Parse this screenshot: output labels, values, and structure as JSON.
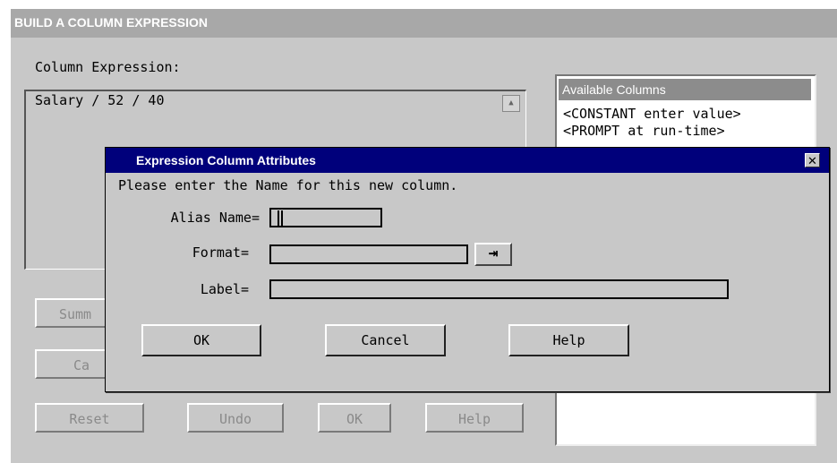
{
  "background_window": {
    "title": "BUILD A COLUMN EXPRESSION",
    "expression_label": "Column Expression:",
    "expression_value": "Salary / 52 / 40",
    "available_columns": {
      "header": "Available Columns",
      "items": [
        "<CONSTANT enter value>",
        "<PROMPT at run-time>"
      ]
    },
    "partial_buttons": [
      "Summ",
      "Ca"
    ],
    "buttons": [
      "Reset",
      "Undo",
      "OK",
      "Help"
    ]
  },
  "dialog": {
    "title": "Expression Column Attributes",
    "close_glyph": "✕",
    "message": "Please enter the Name for this new column.",
    "fields": {
      "alias": {
        "label": "Alias Name=",
        "value": ""
      },
      "format": {
        "label": "Format=",
        "value": ""
      },
      "label": {
        "label": "Label=",
        "value": ""
      }
    },
    "format_button_glyph": "⇥",
    "buttons": {
      "ok": "OK",
      "cancel": "Cancel",
      "help": "Help"
    }
  }
}
